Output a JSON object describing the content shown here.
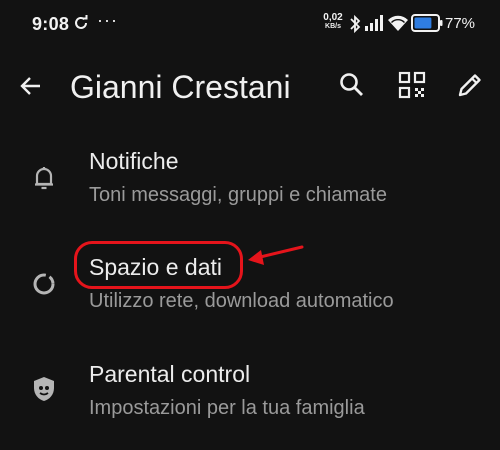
{
  "status_bar": {
    "time": "9:08",
    "overflow": "···",
    "net_speed_value": "0,02",
    "net_speed_unit": "KB/s",
    "battery_percent": "77%",
    "battery_level": 0.77,
    "battery_color": "#2f7de1",
    "icons": [
      "sync-icon",
      "bluetooth-icon",
      "signal-icon",
      "wifi-icon",
      "battery-icon"
    ]
  },
  "app_bar": {
    "title": "Gianni Crestani",
    "icons": [
      "back-arrow-icon",
      "search-icon",
      "qr-code-icon",
      "edit-pencil-icon"
    ]
  },
  "settings": {
    "items": [
      {
        "title": "Notifiche",
        "subtitle": "Toni messaggi, gruppi e chiamate",
        "icon": "bell-icon"
      },
      {
        "title": "Spazio e dati",
        "subtitle": "Utilizzo rete, download automatico",
        "icon": "storage-ring-icon"
      },
      {
        "title": "Parental control",
        "subtitle": "Impostazioni per la tua famiglia",
        "icon": "shield-face-icon"
      }
    ]
  },
  "annotation": {
    "color": "#e5141b",
    "target": "Spazio e dati"
  }
}
